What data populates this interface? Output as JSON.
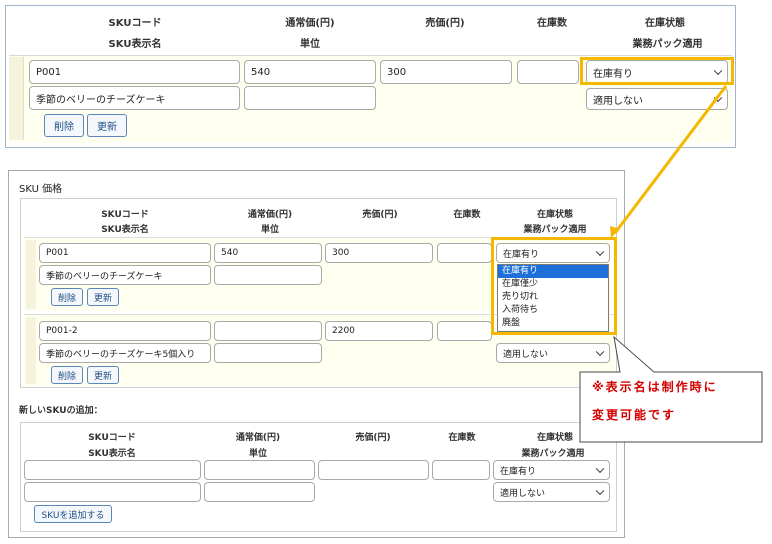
{
  "headers": {
    "sku_code": "SKUコード",
    "regular_price": "通常価(円)",
    "sale_price": "売価(円)",
    "stock_qty": "在庫数",
    "stock_status": "在庫状態",
    "sku_name": "SKU表示名",
    "unit": "単位",
    "business_pack": "業務パック適用"
  },
  "top_row": {
    "sku_code": "P001",
    "regular_price": "540",
    "sale_price": "300",
    "stock_qty": "",
    "stock_status": "在庫有り",
    "sku_name": "季節のベリーのチーズケーキ",
    "unit": "",
    "business_pack": "適用しない",
    "delete_label": "削除",
    "update_label": "更新"
  },
  "panel": {
    "title": "SKU 価格",
    "rows": [
      {
        "sku_code": "P001",
        "regular_price": "540",
        "sale_price": "300",
        "stock_qty": "",
        "stock_status": "在庫有り",
        "sku_name": "季節のベリーのチーズケーキ",
        "unit": "",
        "business_pack": "",
        "delete_label": "削除",
        "update_label": "更新"
      },
      {
        "sku_code": "P001-2",
        "regular_price": "",
        "sale_price": "2200",
        "stock_qty": "",
        "stock_status": "",
        "sku_name": "季節のベリーのチーズケーキ5個入り",
        "unit": "",
        "business_pack": "適用しない",
        "delete_label": "削除",
        "update_label": "更新"
      }
    ],
    "dropdown_options": [
      "在庫有り",
      "在庫僅少",
      "売り切れ",
      "入荷待ち",
      "廃盤"
    ],
    "dropdown_selected_index": 0,
    "new_sku_label": "新しいSKUの追加：",
    "new_row": {
      "sku_code": "",
      "regular_price": "",
      "sale_price": "",
      "stock_qty": "",
      "stock_status": "在庫有り",
      "sku_name": "",
      "unit": "",
      "business_pack": "適用しない"
    },
    "add_button_label": "SKUを追加する"
  },
  "callout": {
    "line1": "※表示名は制作時に",
    "line2": "変更可能です"
  },
  "colors": {
    "highlight": "#f5b800",
    "row_bg": "#fffff0",
    "dropdown_selected": "#1e6fd9",
    "callout_text": "#d40000",
    "button_border": "#5b87b8"
  }
}
